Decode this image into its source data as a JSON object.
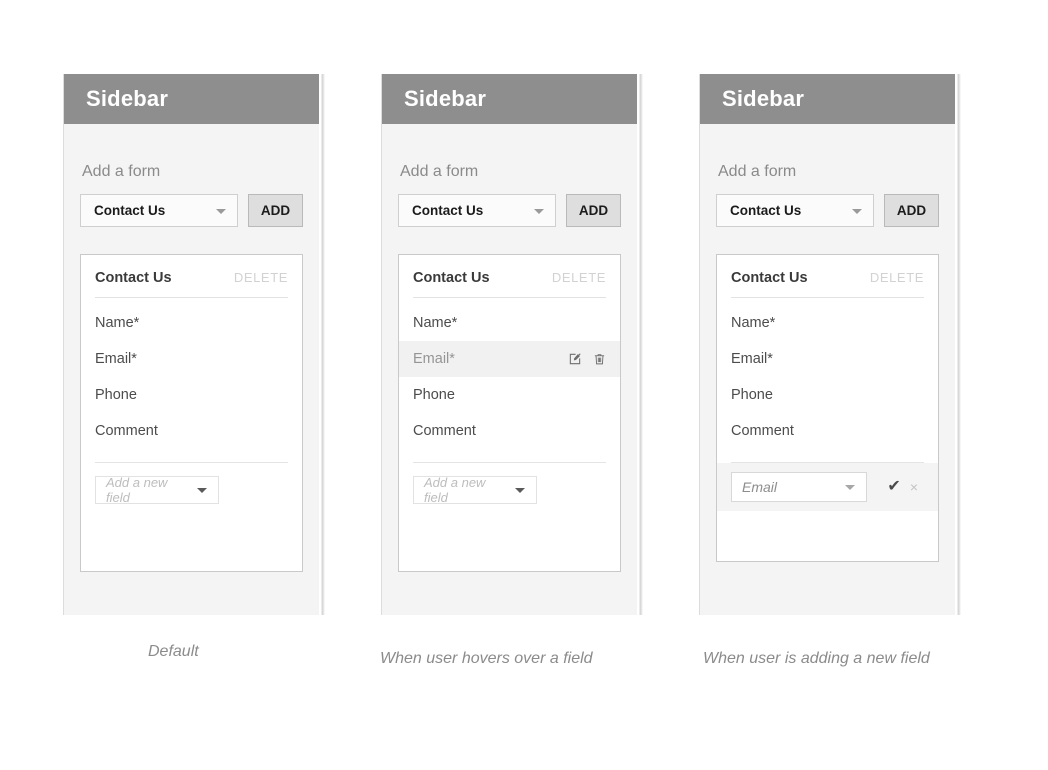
{
  "panels": [
    {
      "header_title": "Sidebar",
      "add_form_label": "Add a form",
      "form_select_value": "Contact Us",
      "add_button_label": "ADD",
      "card": {
        "title": "Contact Us",
        "delete_label": "DELETE",
        "fields": [
          "Name*",
          "Email*",
          "Phone",
          "Comment"
        ],
        "new_field_placeholder": "Add a new field"
      },
      "caption": "Default"
    },
    {
      "header_title": "Sidebar",
      "add_form_label": "Add a form",
      "form_select_value": "Contact Us",
      "add_button_label": "ADD",
      "card": {
        "title": "Contact Us",
        "delete_label": "DELETE",
        "fields": [
          "Name*",
          "Email*",
          "Phone",
          "Comment"
        ],
        "hovered_field": "Email*",
        "edit_icon": "edit-pencil-icon",
        "delete_icon": "trash-icon",
        "new_field_placeholder": "Add a new field"
      },
      "caption": "When user hovers over a field"
    },
    {
      "header_title": "Sidebar",
      "add_form_label": "Add a form",
      "form_select_value": "Contact Us",
      "add_button_label": "ADD",
      "card": {
        "title": "Contact Us",
        "delete_label": "DELETE",
        "fields": [
          "Name*",
          "Email*",
          "Phone",
          "Comment"
        ],
        "new_field_value": "Email",
        "confirm_icon": "check-icon",
        "cancel_icon": "close-x-icon"
      },
      "caption": "When user is adding a new field"
    }
  ],
  "colors": {
    "header_gray": "#8e8e8e",
    "sidebar_body": "#f4f4f4",
    "add_button": "#dedede",
    "hover_row": "#f1f1f1",
    "page_background": "#ffffff"
  },
  "glyphs": {
    "check": "✔",
    "close": "×"
  }
}
